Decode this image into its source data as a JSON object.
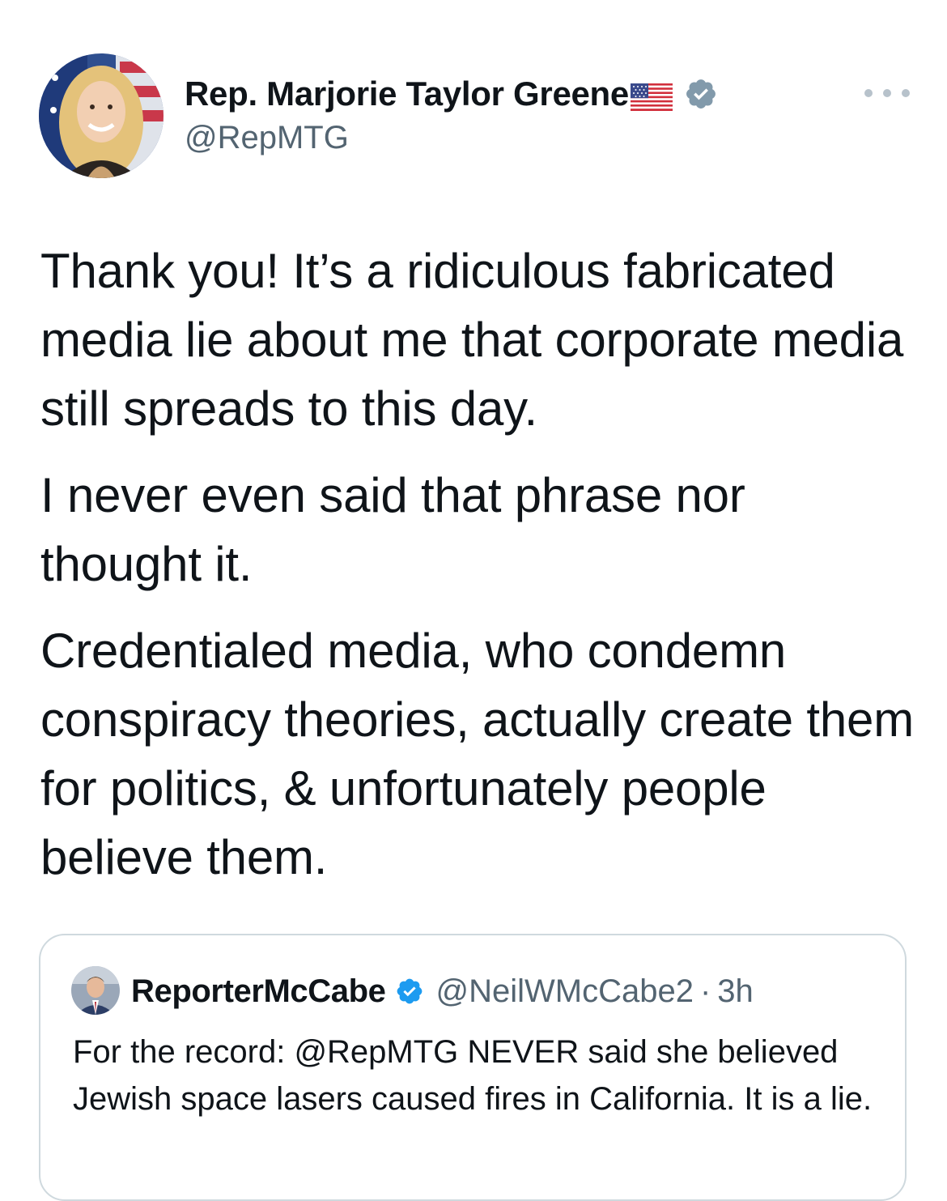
{
  "tweet": {
    "author_name": "Rep. Marjorie Taylor Greene",
    "author_handle": "@RepMTG",
    "flag_emoji": "us-flag-icon",
    "verified": "verified-badge-icon",
    "more_menu": "more-options-icon",
    "paragraphs": [
      "Thank you! It’s a ridiculous fabricated media lie about me that corporate media still spreads to this day.",
      "I never even said that phrase nor thought it.",
      "Credentialed media, who condemn conspiracy theories, actually create them for politics, & unfortunately people believe them."
    ]
  },
  "quote": {
    "author_name": "ReporterMcCabe",
    "author_handle": "@NeilWMcCabe2",
    "separator": "·",
    "time": "3h",
    "text": "For the record: @RepMTG NEVER said she believed Jewish space lasers caused fires in California. It is a lie."
  },
  "colors": {
    "text": "#0f1419",
    "secondary": "#536471",
    "verified": "#1d9bf0",
    "border": "#cfd9de"
  }
}
